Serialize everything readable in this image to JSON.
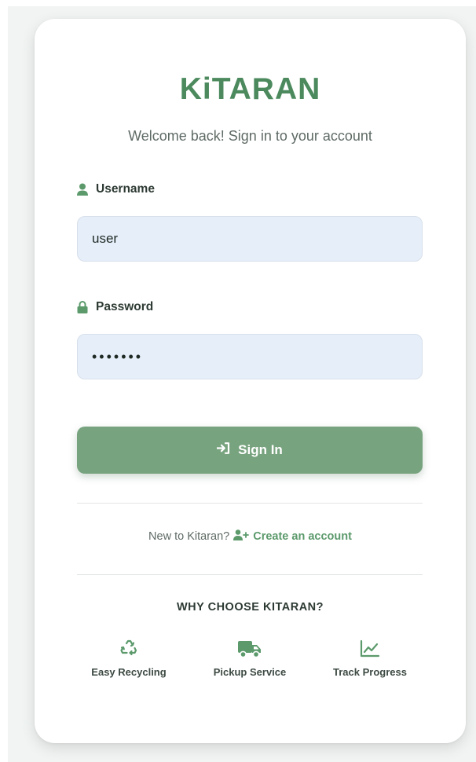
{
  "brand": {
    "name": "KiTARAN"
  },
  "subtitle": "Welcome back! Sign in to your account",
  "form": {
    "username_label": "Username",
    "username_value": "user",
    "password_label": "Password",
    "password_value": "•••••••",
    "signin_label": "Sign In"
  },
  "register": {
    "prompt": "New to Kitaran?",
    "link_label": "Create an account"
  },
  "features": {
    "heading": "WHY CHOOSE KITARAN?",
    "items": [
      {
        "label": "Easy Recycling",
        "icon": "recycle-icon"
      },
      {
        "label": "Pickup Service",
        "icon": "truck-icon"
      },
      {
        "label": "Track Progress",
        "icon": "chart-line-icon"
      }
    ]
  },
  "colors": {
    "brand": "#4c8a5e",
    "button": "#78a37f",
    "icon": "#5c9a6c",
    "input_bg": "#e6eefa"
  }
}
